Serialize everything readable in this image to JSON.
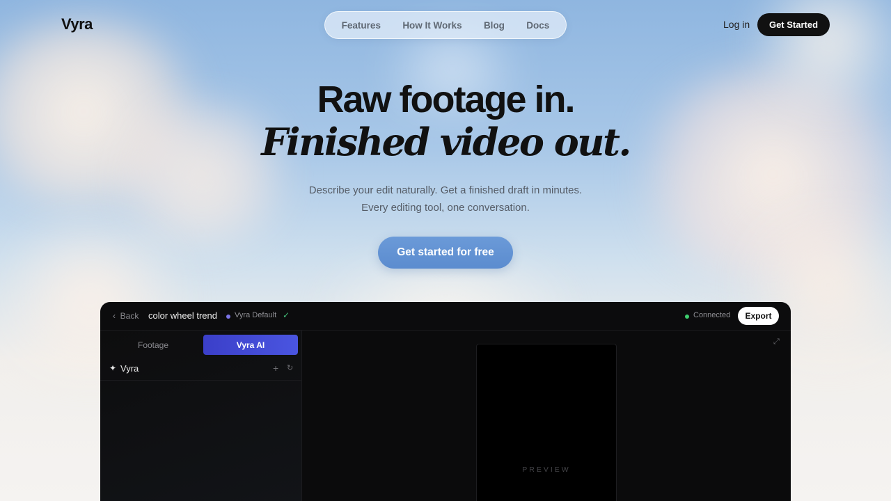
{
  "brand": {
    "name": "Vyra"
  },
  "nav": {
    "items": [
      {
        "label": "Features"
      },
      {
        "label": "How It Works"
      },
      {
        "label": "Blog"
      },
      {
        "label": "Docs"
      }
    ],
    "login_label": "Log in",
    "get_started_label": "Get Started"
  },
  "hero": {
    "headline_line1": "Raw footage in.",
    "headline_line2": "Finished video out.",
    "subtitle_line1": "Describe your edit naturally. Get a finished draft in minutes.",
    "subtitle_line2": "Every editing tool, one conversation.",
    "cta_label": "Get started for free"
  },
  "app": {
    "back_label": "Back",
    "project_title": "color wheel trend",
    "preset_label": "Vyra Default",
    "status_label": "Connected",
    "export_label": "Export",
    "tabs": [
      {
        "label": "Footage",
        "active": false
      },
      {
        "label": "Vyra AI",
        "active": true
      }
    ],
    "chat_title": "Vyra",
    "preview_label": "PREVIEW"
  },
  "colors": {
    "accent": "#4a55e0",
    "cta": "#5b8ccf",
    "status_connected": "#3ecf6e",
    "preset_dot": "#7b74e6"
  }
}
